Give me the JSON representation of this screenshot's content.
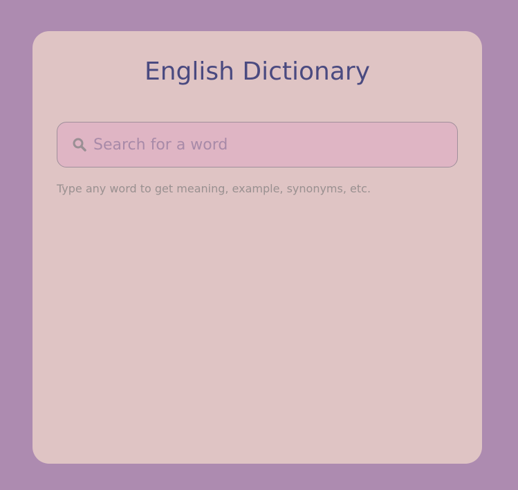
{
  "app": {
    "title": "English Dictionary"
  },
  "search": {
    "placeholder": "Search for a word",
    "value": "",
    "icon": "search-icon"
  },
  "hint": {
    "text": "Type any word to get meaning, example, synonyms, etc."
  },
  "colors": {
    "background": "#ad8bb0",
    "card": "#dfc4c4",
    "title": "#4a4a80",
    "search_field": "#dfb5c4",
    "placeholder": "#a88aa8",
    "hint": "#999090"
  }
}
